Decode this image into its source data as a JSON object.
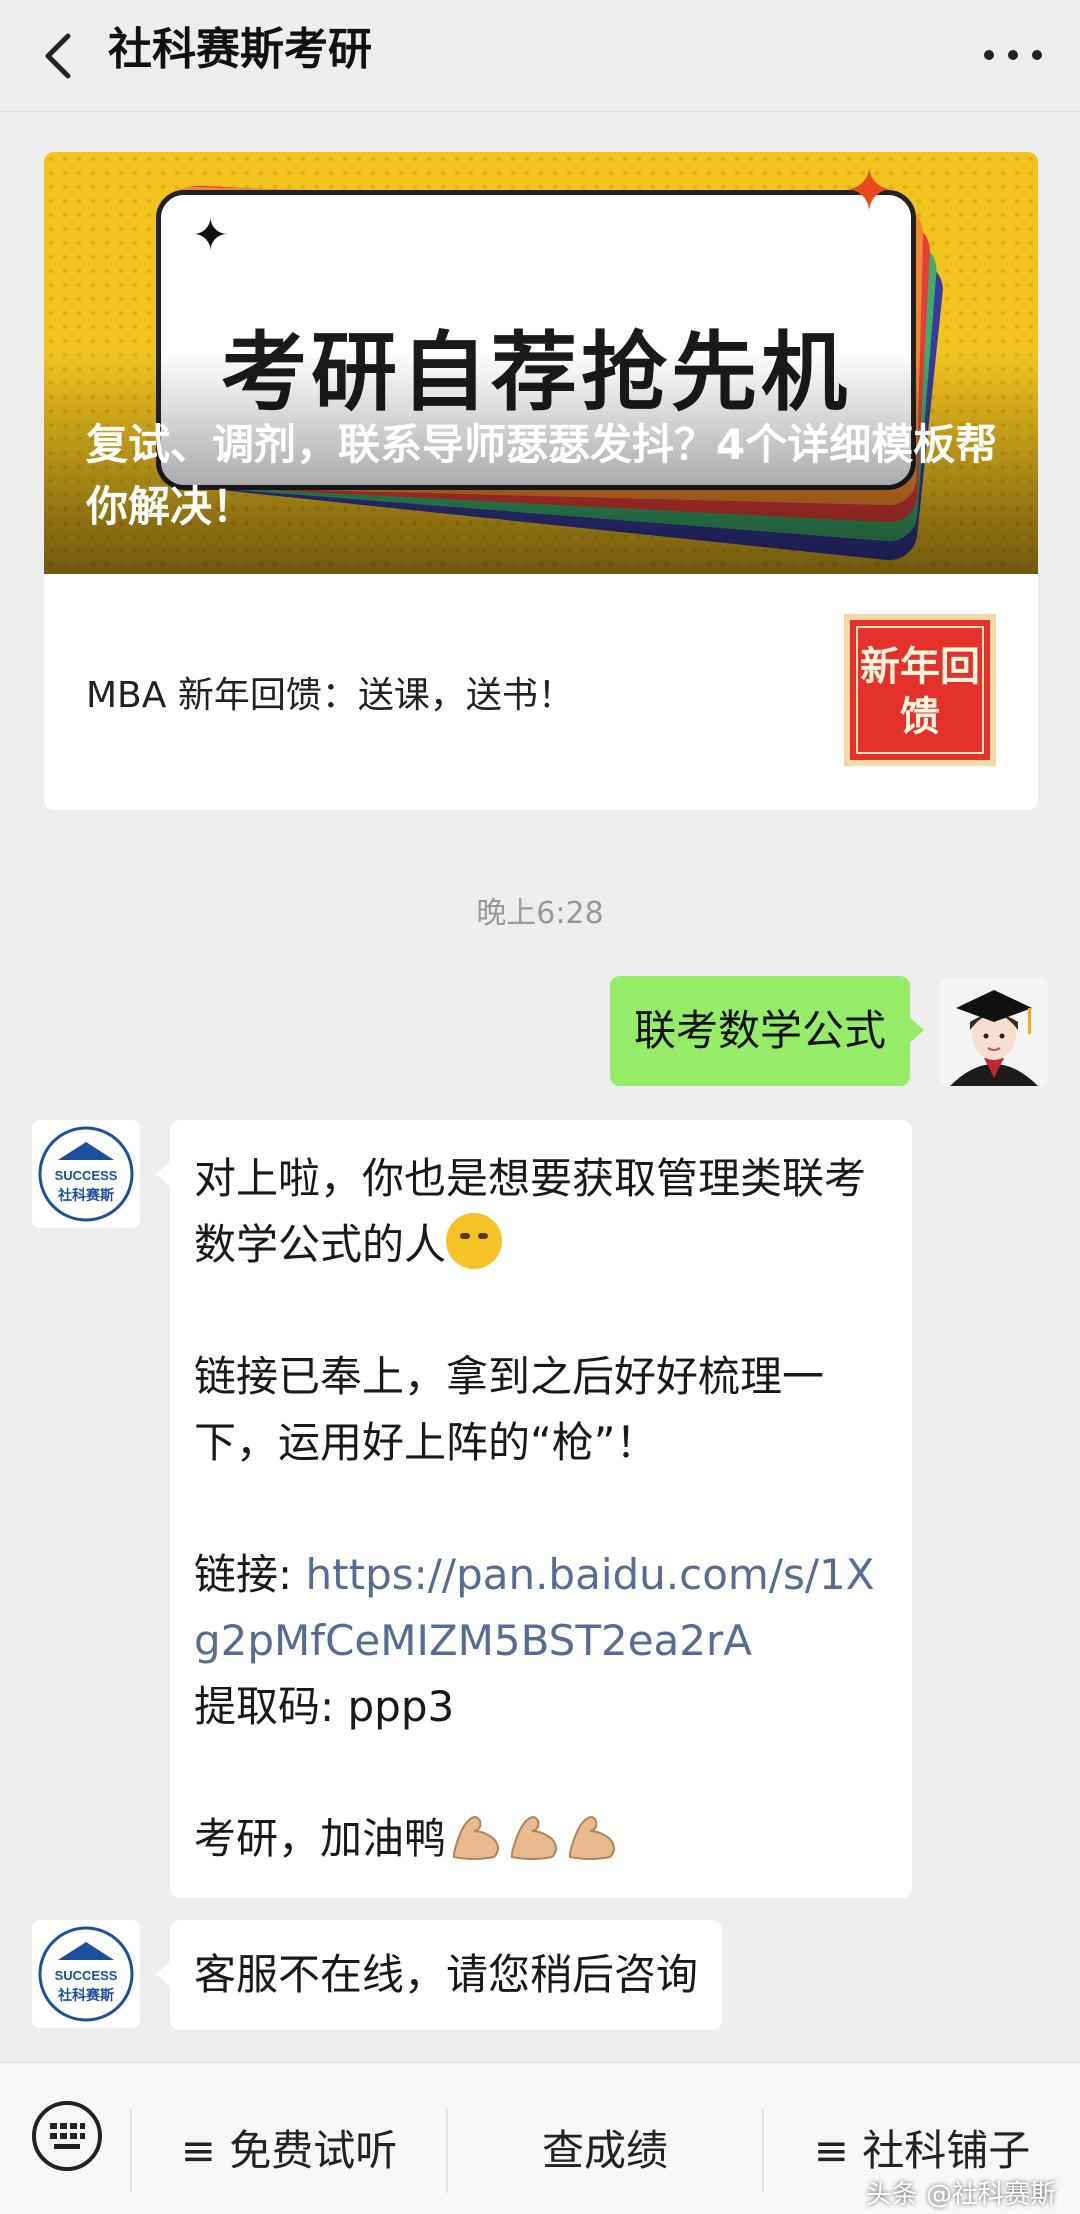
{
  "header": {
    "title": "社科赛斯考研"
  },
  "article": {
    "cover_title": "考研自荐抢先机",
    "cover_caption": "复试、调剂，联系导师瑟瑟发抖？4个详细模板帮你解决！",
    "sub_item": "MBA 新年回馈：送课，送书！",
    "thumb_text": "新年回馈"
  },
  "time_label": "晚上6:28",
  "messages": {
    "user_text": "联考数学公式",
    "bot_reply": {
      "p1": "对上啦，你也是想要获取管理类联考数学公式的人",
      "p2": "链接已奉上，拿到之后好好梳理一下，运用好上阵的“枪”！",
      "link_label": "链接: ",
      "link_url": "https://pan.baidu.com/s/1Xg2pMfCeMIZM5BST2ea2rA",
      "code_line": "提取码: ppp3",
      "p4": "考研，加油鸭"
    },
    "bot_offline": "客服不在线，请您稍后咨询"
  },
  "bot_avatar": {
    "brand": "SUCCESS",
    "name": "社科赛斯"
  },
  "bottom_menu": {
    "item1": "≡ 免费试听",
    "item2": "查成绩",
    "item3": "≡ 社科铺子"
  },
  "watermark": "头条 @社科赛斯",
  "colors": {
    "bubble_right": "#95ec69",
    "link": "#576b95",
    "cover_yellow": "#f2c31f"
  }
}
